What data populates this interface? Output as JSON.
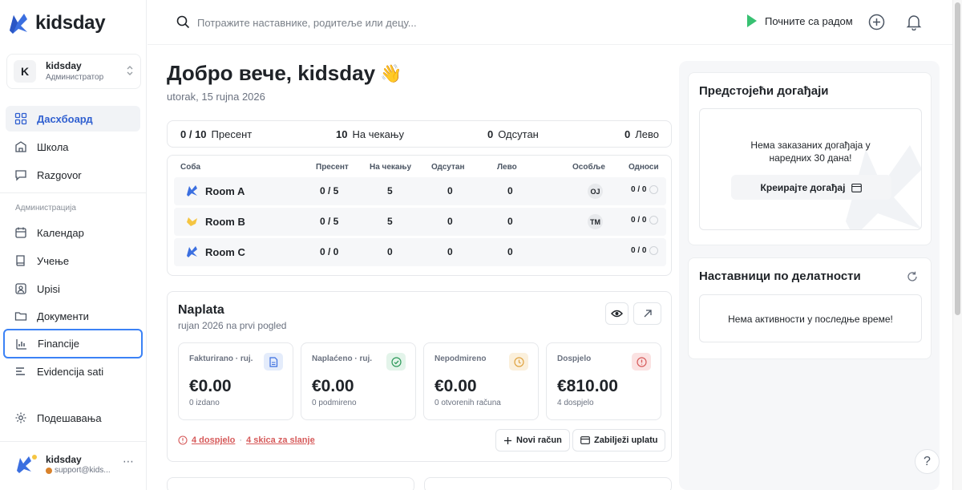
{
  "brand": {
    "name": "kidsday"
  },
  "account": {
    "initial": "K",
    "name": "kidsday",
    "role": "Администратор"
  },
  "nav": {
    "items": [
      {
        "label": "Дасхбоард",
        "icon": "dashboard-icon"
      },
      {
        "label": "Школа",
        "icon": "school-icon"
      },
      {
        "label": "Razgovor",
        "icon": "chat-icon"
      }
    ],
    "section_label": "Администрација",
    "admin_items": [
      {
        "label": "Календар",
        "icon": "calendar-icon"
      },
      {
        "label": "Учење",
        "icon": "book-icon"
      },
      {
        "label": "Upisi",
        "icon": "user-icon"
      },
      {
        "label": "Документи",
        "icon": "folder-icon"
      },
      {
        "label": "Financije",
        "icon": "chart-icon"
      },
      {
        "label": "Evidencija sati",
        "icon": "timesheet-icon"
      }
    ],
    "settings_label": "Подешавања"
  },
  "user": {
    "name": "kidsday",
    "email": "support@kids..."
  },
  "search": {
    "placeholder": "Потражите наставнике, родитеље или децу..."
  },
  "topbar": {
    "start_label": "Почните са радом"
  },
  "greeting": {
    "text": "Добро вече, kidsday",
    "emoji": "👋",
    "date": "utorak, 15 rujna 2026"
  },
  "summary": {
    "present_count": "0 / 10",
    "present_label": "Пресент",
    "waiting_count": "10",
    "waiting_label": "На чекању",
    "absent_count": "0",
    "absent_label": "Одсутан",
    "left_count": "0",
    "left_label": "Лево"
  },
  "rooms_table": {
    "headers": {
      "room": "Соба",
      "present": "Пресент",
      "waiting": "На чекању",
      "absent": "Одсутан",
      "left": "Лево",
      "staff": "Особље",
      "relations": "Односи"
    },
    "rows": [
      {
        "name": "Room A",
        "present": "0 / 5",
        "waiting": "5",
        "absent": "0",
        "left": "0",
        "staff": "OJ",
        "relations": "0 / 0",
        "color": "#3b6fe0"
      },
      {
        "name": "Room B",
        "present": "0 / 5",
        "waiting": "5",
        "absent": "0",
        "left": "0",
        "staff": "TM",
        "relations": "0 / 0",
        "color": "#f5c542"
      },
      {
        "name": "Room C",
        "present": "0 / 0",
        "waiting": "0",
        "absent": "0",
        "left": "0",
        "staff": "",
        "relations": "0 / 0",
        "color": "#3b6fe0"
      }
    ]
  },
  "billing": {
    "title": "Naplata",
    "subtitle": "rujan 2026 na prvi pogled",
    "stats": [
      {
        "label": "Fakturirano · ruj.",
        "value": "€0.00",
        "note": "0 izdano",
        "icon": "document-icon",
        "color": "#3b6fe0"
      },
      {
        "label": "Naplaćeno · ruj.",
        "value": "€0.00",
        "note": "0 podmireno",
        "icon": "check-circle-icon",
        "color": "#2e9a5b"
      },
      {
        "label": "Nepodmireno",
        "value": "€0.00",
        "note": "0 otvorenih računa",
        "icon": "clock-icon",
        "color": "#e0a340"
      },
      {
        "label": "Dospjelo",
        "value": "€810.00",
        "note": "4 dospjelo",
        "icon": "alert-circle-icon",
        "color": "#d65a5a"
      }
    ],
    "alert_overdue": "4 dospjelo",
    "alert_separator": "·",
    "alert_drafts": "4 skica za slanje",
    "new_invoice_label": "Novi račun",
    "record_payment_label": "Zabilježi uplatu"
  },
  "events": {
    "title": "Предстојећи догађаји",
    "empty_text": "Нема заказаних догађаја у наредних 30 дана!",
    "create_label": "Креирајте догађај"
  },
  "teachers": {
    "title": "Наставници по делатности",
    "empty_text": "Нема активности у последње време!"
  },
  "help_label": "?"
}
